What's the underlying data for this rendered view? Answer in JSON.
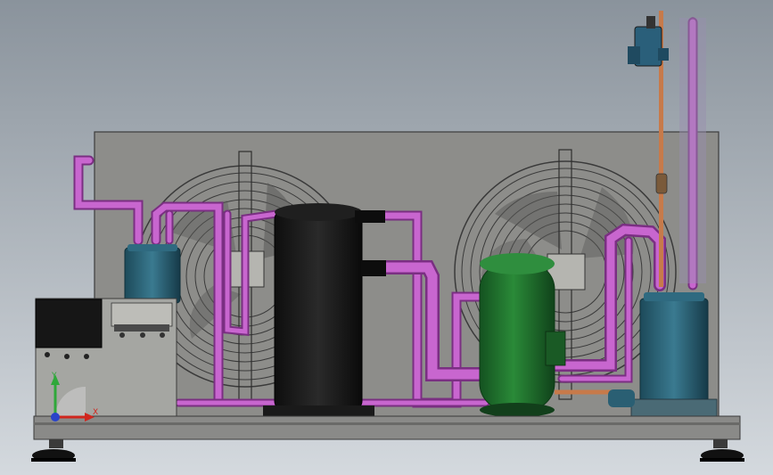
{
  "colors": {
    "background_top": "#8a939c",
    "background_bottom": "#d4d9de",
    "panel": "#8d8d8a",
    "pipe": "#b04db8",
    "pipe_dark": "#7a2f82",
    "compressor": "#1a1a1a",
    "receiver": "#1f6b2a",
    "accumulator": "#2a5f73",
    "copper": "#c77a4a",
    "fan_guard": "#3a3a3a",
    "base_frame": "#7e7e7e",
    "axis_x": "#d0261e",
    "axis_y": "#2fa83a",
    "axis_z": "#2a43c9"
  },
  "components": {
    "left_fan": "condenser-fan",
    "right_fan": "condenser-fan",
    "compressor": "scroll-compressor",
    "receiver": "liquid-receiver",
    "left_tank": "suction-accumulator",
    "right_tank": "oil-separator",
    "control_box": "electrical-control-box",
    "solenoid": "solenoid-valve"
  },
  "triad": {
    "x_label": "X",
    "y_label": "Y"
  }
}
